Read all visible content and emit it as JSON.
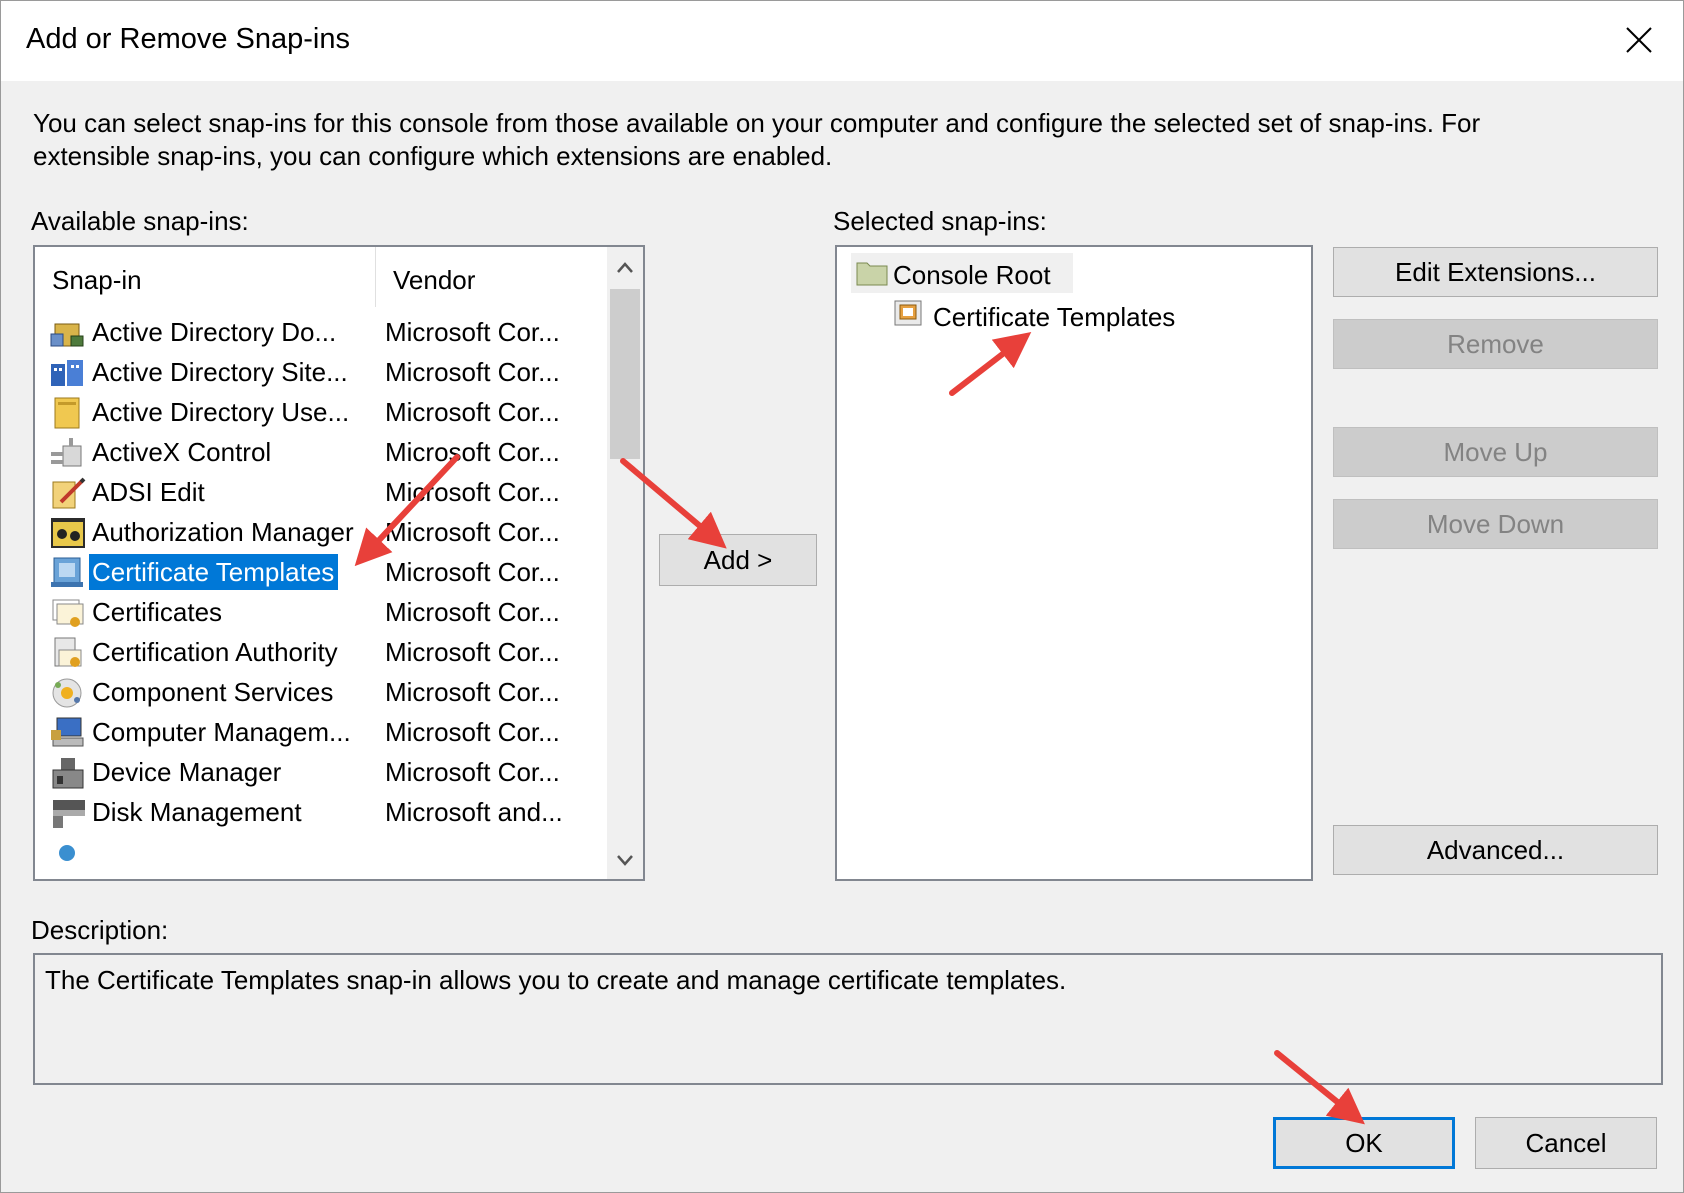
{
  "window": {
    "title": "Add or Remove Snap-ins",
    "intro": "You can select snap-ins for this console from those available on your computer and configure the selected set of snap-ins. For extensible snap-ins, you can configure which extensions are enabled."
  },
  "available": {
    "label": "Available snap-ins:",
    "columns": {
      "snapin": "Snap-in",
      "vendor": "Vendor"
    },
    "items": [
      {
        "name": "Active Directory Do...",
        "vendor": "Microsoft Cor...",
        "icon": "ad-domains-icon"
      },
      {
        "name": "Active Directory Site...",
        "vendor": "Microsoft Cor...",
        "icon": "ad-sites-icon"
      },
      {
        "name": "Active Directory Use...",
        "vendor": "Microsoft Cor...",
        "icon": "ad-users-icon"
      },
      {
        "name": "ActiveX Control",
        "vendor": "Microsoft Cor...",
        "icon": "activex-icon"
      },
      {
        "name": "ADSI Edit",
        "vendor": "Microsoft Cor...",
        "icon": "adsi-edit-icon"
      },
      {
        "name": "Authorization Manager",
        "vendor": "Microsoft Cor...",
        "icon": "authorization-icon"
      },
      {
        "name": "Certificate Templates",
        "vendor": "Microsoft Cor...",
        "icon": "certificate-template-icon",
        "selected": true
      },
      {
        "name": "Certificates",
        "vendor": "Microsoft Cor...",
        "icon": "certificates-icon"
      },
      {
        "name": "Certification Authority",
        "vendor": "Microsoft Cor...",
        "icon": "certification-authority-icon"
      },
      {
        "name": "Component Services",
        "vendor": "Microsoft Cor...",
        "icon": "component-services-icon"
      },
      {
        "name": "Computer Managem...",
        "vendor": "Microsoft Cor...",
        "icon": "computer-management-icon"
      },
      {
        "name": "Device Manager",
        "vendor": "Microsoft Cor...",
        "icon": "device-manager-icon"
      },
      {
        "name": "Disk Management",
        "vendor": "Microsoft and...",
        "icon": "disk-management-icon"
      }
    ]
  },
  "add_button": "Add >",
  "selected": {
    "label": "Selected snap-ins:",
    "root": "Console Root",
    "child": "Certificate Templates"
  },
  "buttons": {
    "edit_extensions": "Edit Extensions...",
    "remove": "Remove",
    "move_up": "Move Up",
    "move_down": "Move Down",
    "advanced": "Advanced...",
    "ok": "OK",
    "cancel": "Cancel"
  },
  "description": {
    "label": "Description:",
    "text": "The Certificate Templates snap-in allows you to create and manage certificate templates."
  },
  "colors": {
    "selection": "#0078d7",
    "annotation_arrow": "#e8403a"
  }
}
